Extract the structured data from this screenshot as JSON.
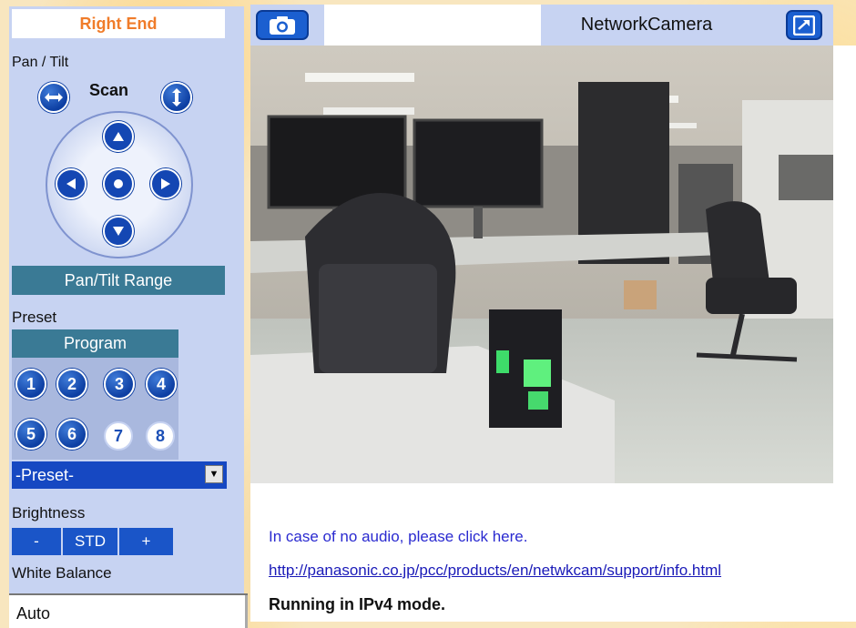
{
  "panel": {
    "position_mode": "Right End",
    "pan_tilt_label": "Pan / Tilt",
    "scan_label": "Scan",
    "pan_tilt_range_label": "Pan/Tilt Range",
    "preset_label": "Preset",
    "program_label": "Program",
    "preset_numbers": [
      "1",
      "2",
      "3",
      "4",
      "5",
      "6",
      "7",
      "8"
    ],
    "preset_select_value": "-Preset-",
    "brightness_label": "Brightness",
    "brightness_buttons": [
      "-",
      "STD",
      "+"
    ],
    "white_balance_label": "White Balance",
    "white_balance_value": "Auto"
  },
  "topbar": {
    "title": "NetworkCamera"
  },
  "footer": {
    "audio_link": "In case of no audio, please click here.",
    "support_link": "http://panasonic.co.jp/pcc/products/en/netwkcam/support/info.html",
    "status": "Running in IPv4 mode."
  },
  "icons": {
    "snapshot": "camera-icon",
    "fullscreen": "expand-icon",
    "scan_horizontal": "arrows-horizontal-icon",
    "scan_vertical": "arrows-vertical-icon",
    "dropdown": "chevron-down-icon"
  },
  "colors": {
    "accent_blue": "#1648c2",
    "panel_bg": "#c7d3f2",
    "bar_teal": "#3a7a95",
    "position_text": "#f07c2a"
  }
}
